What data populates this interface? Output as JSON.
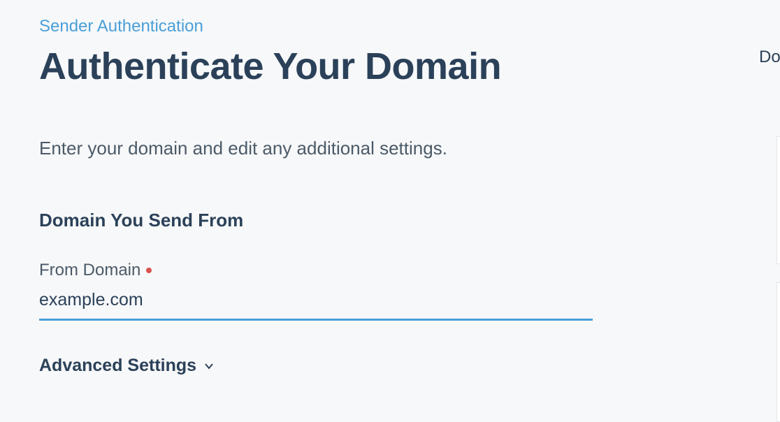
{
  "breadcrumb": {
    "label": "Sender Authentication"
  },
  "header": {
    "title": "Authenticate Your Domain",
    "subtitle": "Enter your domain and edit any additional settings."
  },
  "form": {
    "section_title": "Domain You Send From",
    "from_domain": {
      "label": "From Domain",
      "required": true,
      "value": "example.com"
    }
  },
  "advanced": {
    "label": "Advanced Settings"
  },
  "right_panel": {
    "partial_text": "Do"
  }
}
